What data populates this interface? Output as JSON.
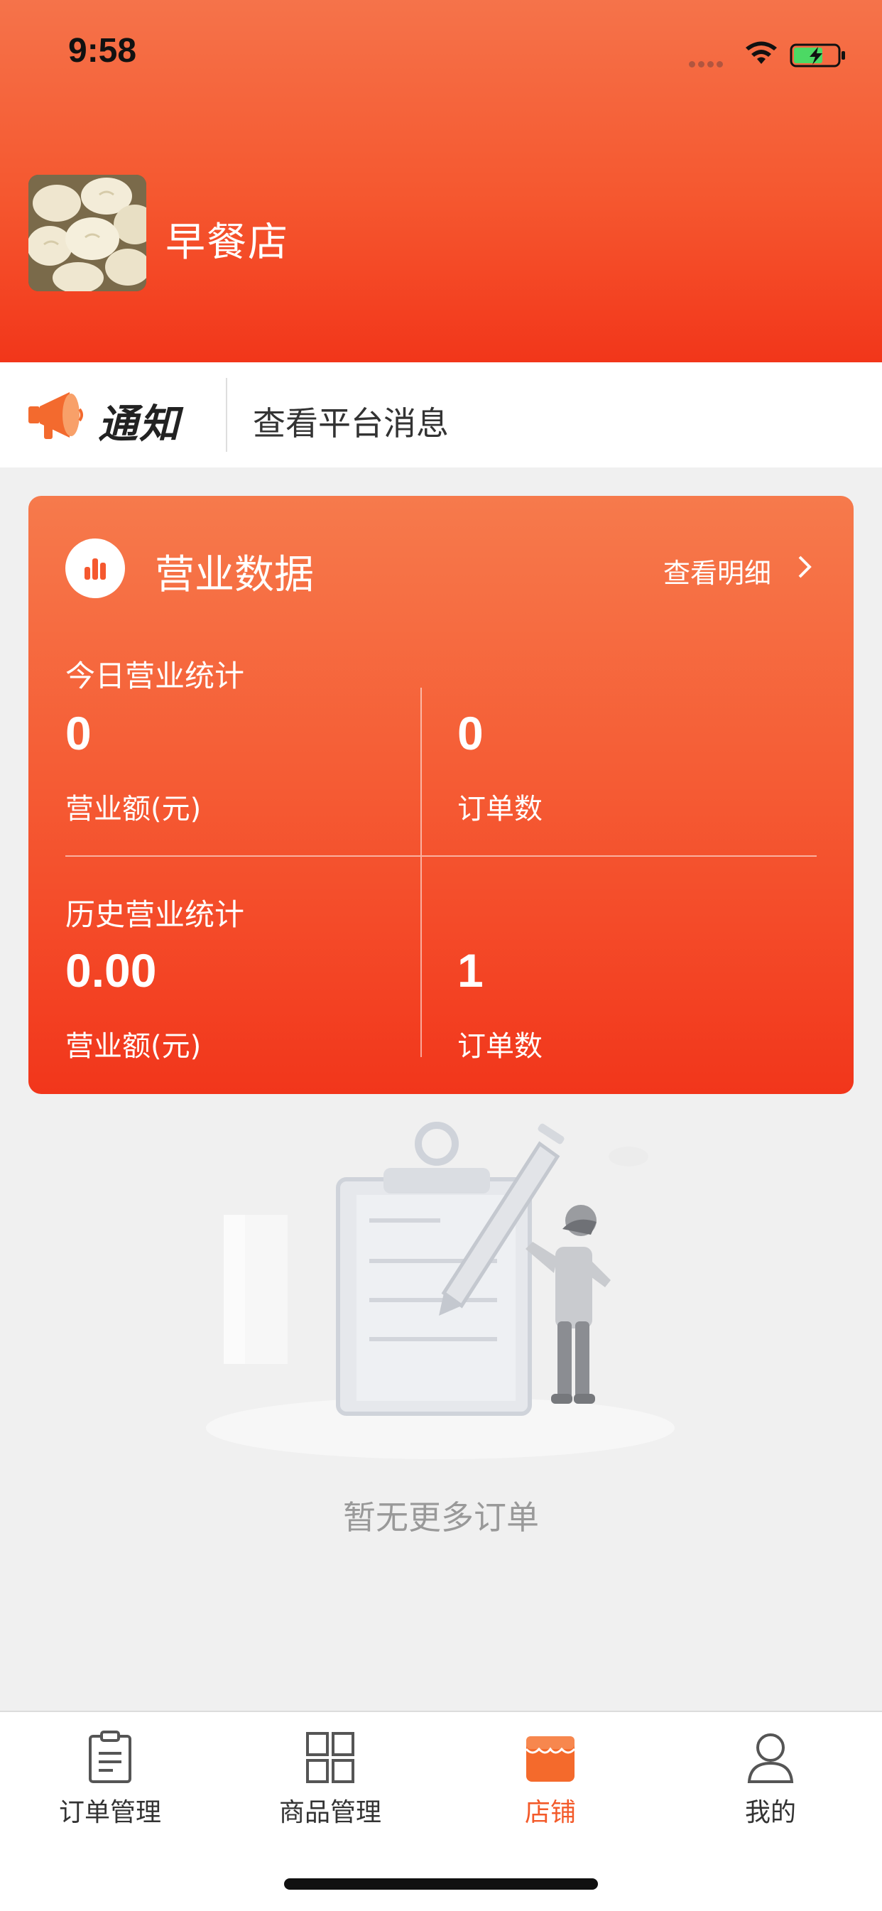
{
  "status_bar": {
    "time": "9:58"
  },
  "shop": {
    "name": "早餐店"
  },
  "notice": {
    "title": "通知",
    "text": "查看平台消息"
  },
  "business": {
    "title": "营业数据",
    "detail_link": "查看明细",
    "today": {
      "label": "今日营业统计",
      "revenue_value": "0",
      "revenue_label": "营业额(元)",
      "orders_value": "0",
      "orders_label": "订单数"
    },
    "history": {
      "label": "历史营业统计",
      "revenue_value": "0.00",
      "revenue_label": "营业额(元)",
      "orders_value": "1",
      "orders_label": "订单数"
    }
  },
  "empty_state": {
    "text": "暂无更多订单"
  },
  "tabs": [
    {
      "label": "订单管理",
      "icon": "clipboard-icon"
    },
    {
      "label": "商品管理",
      "icon": "grid-icon"
    },
    {
      "label": "店铺",
      "icon": "shop-icon",
      "active": true
    },
    {
      "label": "我的",
      "icon": "user-icon"
    }
  ],
  "colors": {
    "accent": "#f35a2a",
    "header_top": "#f5734a",
    "header_bottom": "#f2361a"
  }
}
